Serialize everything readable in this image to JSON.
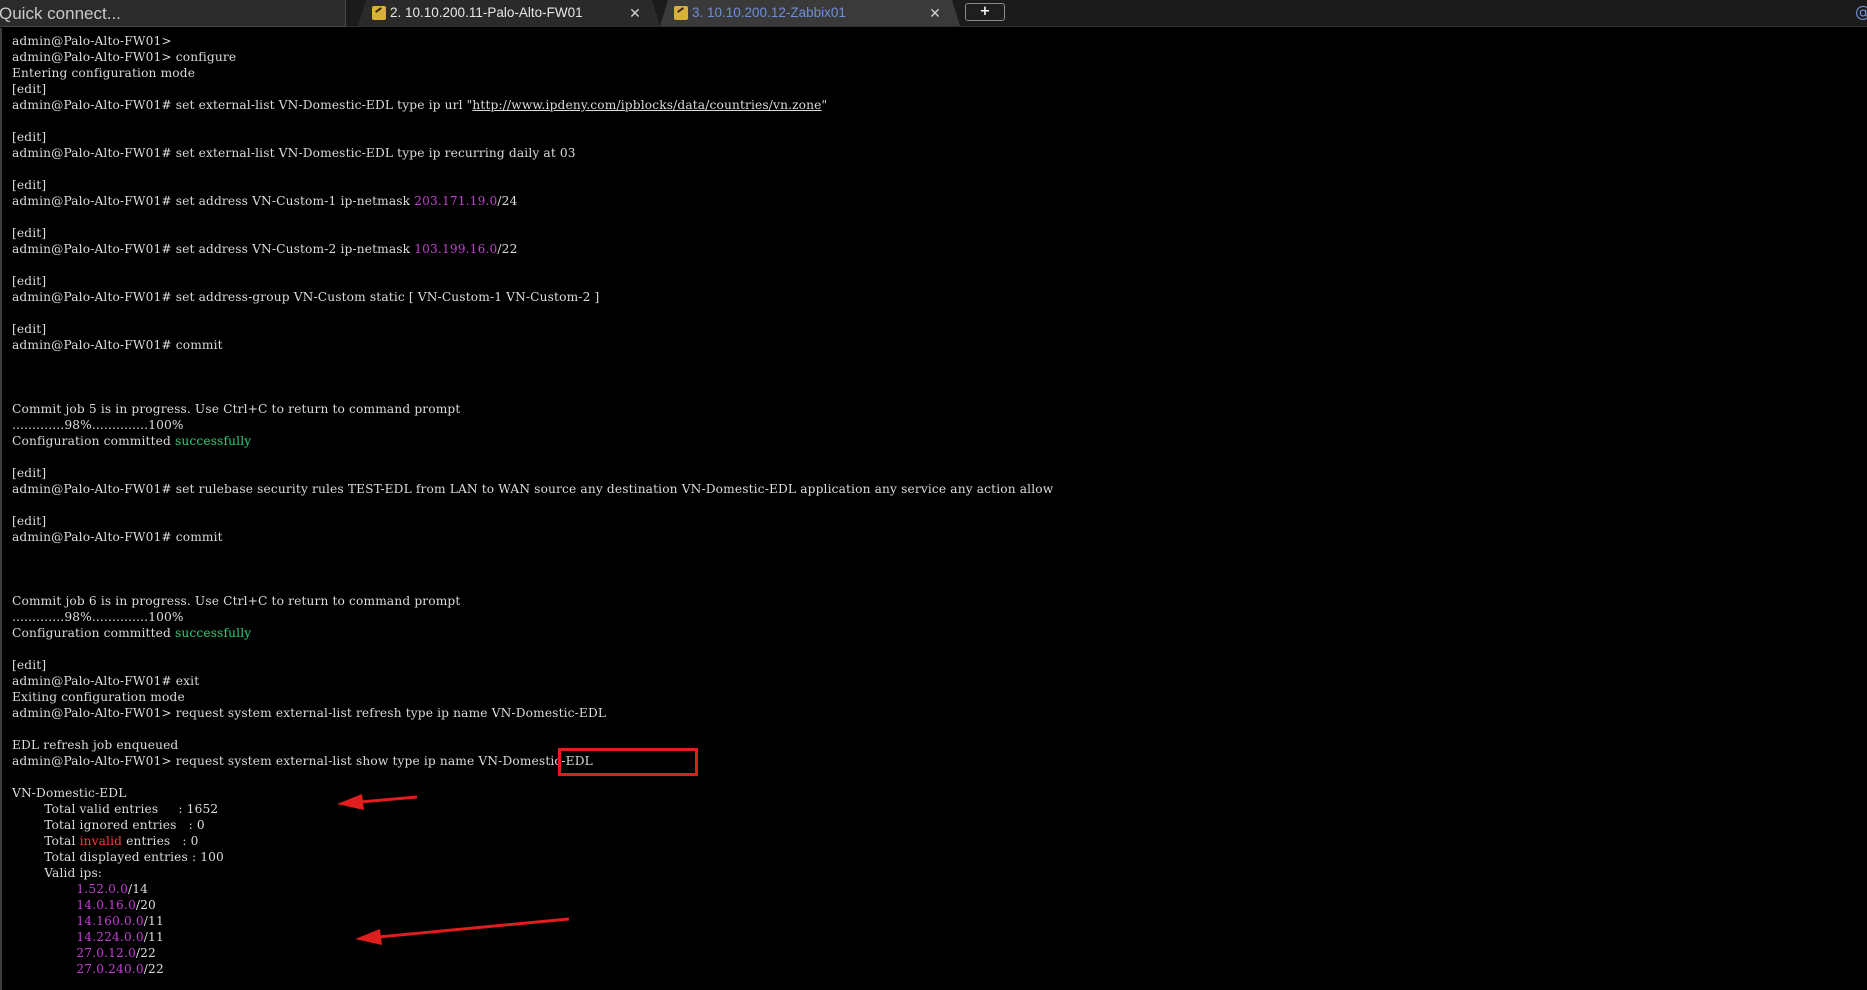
{
  "topbar": {
    "quick_connect_placeholder": "Quick connect...",
    "tabs": [
      {
        "label": "2. 10.10.200.11-Palo-Alto-FW01",
        "close": "✕",
        "active": true
      },
      {
        "label": "3. 10.10.200.12-Zabbix01",
        "close": "✕",
        "active": false
      }
    ],
    "new_tab_label": "+"
  },
  "colors": {
    "ip": "#c03fd0",
    "success": "#2fcf74",
    "invalid": "#ff3b3b",
    "annotation": "#e01e1e"
  },
  "terminal": {
    "lines": [
      "admin@Palo-Alto-FW01>",
      "admin@Palo-Alto-FW01> configure",
      "Entering configuration mode",
      "[edit]",
      "admin@Palo-Alto-FW01# set external-list VN-Domestic-EDL type ip url \"",
      "http://www.ipdeny.com/ipblocks/data/countries/vn.zone",
      "\"",
      "[edit]",
      "admin@Palo-Alto-FW01# set external-list VN-Domestic-EDL type ip recurring daily at 03",
      "[edit]",
      "admin@Palo-Alto-FW01# set address VN-Custom-1 ip-netmask ",
      "203.171.19.0",
      "/24",
      "[edit]",
      "admin@Palo-Alto-FW01# set address VN-Custom-2 ip-netmask ",
      "103.199.16.0",
      "/22",
      "[edit]",
      "admin@Palo-Alto-FW01# set address-group VN-Custom static [ VN-Custom-1 VN-Custom-2 ]",
      "[edit]",
      "admin@Palo-Alto-FW01# commit",
      "Commit job 5 is in progress. Use Ctrl+C to return to command prompt",
      ".............98%..............100%",
      "Configuration committed ",
      "successfully",
      "[edit]",
      "admin@Palo-Alto-FW01# set rulebase security rules TEST-EDL from LAN to WAN source any destination VN-Domestic-EDL application any service any action allow",
      "[edit]",
      "admin@Palo-Alto-FW01# commit",
      "Commit job 6 is in progress. Use Ctrl+C to return to command prompt",
      ".............98%..............100%",
      "Configuration committed ",
      "successfully",
      "[edit]",
      "admin@Palo-Alto-FW01# exit",
      "Exiting configuration mode",
      "admin@Palo-Alto-FW01> request system external-list refresh type ip name VN-Domestic-EDL",
      "EDL refresh job enqueued",
      "admin@Palo-Alto-FW01> request system external-list show type ip name ",
      "VN-Domestic-EDL",
      "VN-Domestic-EDL",
      "        Total valid entries     : 1652",
      "        Total ignored entries   : 0",
      "        Total ",
      "invalid",
      " entries   : 0",
      "        Total displayed entries : 100",
      "        Valid ips:",
      "                ",
      "1.52.0.0",
      "/14",
      "14.0.16.0",
      "/20",
      "14.160.0.0",
      "/11",
      "14.224.0.0",
      "/11",
      "27.0.12.0",
      "/22",
      "27.0.240.0",
      "/22"
    ]
  }
}
